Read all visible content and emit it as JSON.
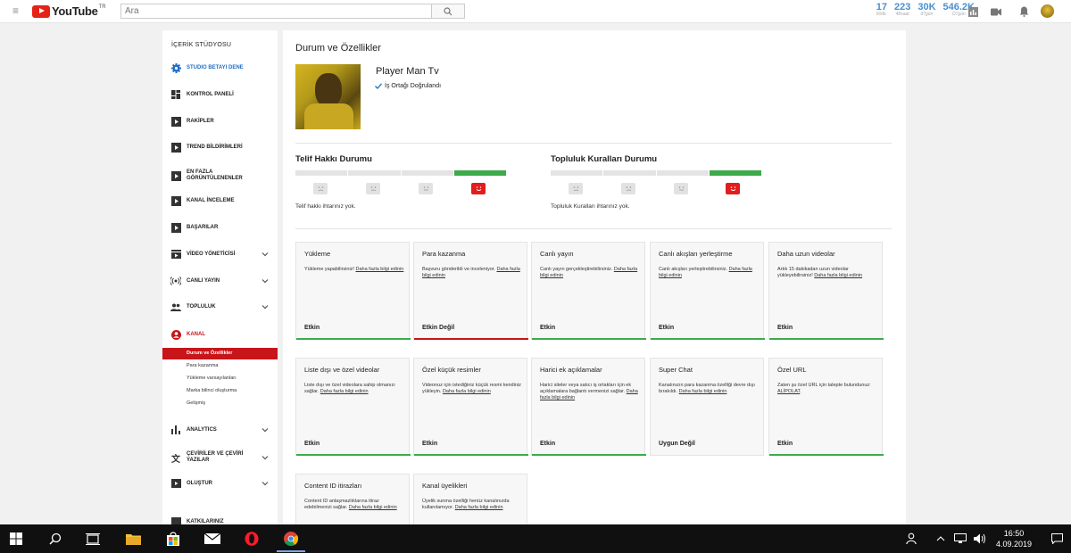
{
  "header": {
    "logo_text": "YouTube",
    "logo_region": "TR",
    "search_placeholder": "Ara",
    "stats": [
      {
        "value": "17",
        "label": "60dk."
      },
      {
        "value": "223",
        "label": "48saat"
      },
      {
        "value": "30K",
        "label": "ð7gün"
      },
      {
        "value": "546.2K",
        "label": "Ö7gün"
      }
    ]
  },
  "sidebar": {
    "title": "İÇERİK STÜDYOSU",
    "items": [
      {
        "label": "STUDIO BETAYI DENE",
        "icon": "gear-icon",
        "color": "#1f6fc3"
      },
      {
        "label": "KONTROL PANELİ",
        "icon": "dashboard-icon"
      },
      {
        "label": "RAKİPLER",
        "icon": "play-box-icon"
      },
      {
        "label": "TREND BİLDİRİMLERİ",
        "icon": "play-box-icon"
      },
      {
        "label": "EN FAZLA GÖRÜNTÜLENENLER",
        "icon": "play-box-icon"
      },
      {
        "label": "KANAL İNCELEME",
        "icon": "play-box-icon"
      },
      {
        "label": "BAŞARILAR",
        "icon": "play-box-icon"
      },
      {
        "label": "VİDEO YÖNETİCİSİ",
        "icon": "video-manager-icon"
      },
      {
        "label": "CANLI YAYIN",
        "icon": "live-icon"
      },
      {
        "label": "TOPLULUK",
        "icon": "people-icon"
      },
      {
        "label": "KANAL",
        "icon": "user-circle-icon",
        "color": "#c8151a"
      }
    ],
    "subitems": [
      "Durum ve Özellikler",
      "Para kazanma",
      "Yükleme varsayılanları",
      "Marka bilinci oluşturma",
      "Gelişmiş"
    ],
    "items_bottom": [
      {
        "label": "ANALYTICS",
        "icon": "bar-chart-icon"
      },
      {
        "label": "ÇEVİRİLER VE ÇEVİRİ YAZILAR",
        "icon": "translate-icon"
      },
      {
        "label": "OLUŞTUR",
        "icon": "film-icon"
      },
      {
        "label": "KATKILARINIZ",
        "icon": "contribution-icon"
      }
    ]
  },
  "main": {
    "title": "Durum ve Özellikler",
    "channel_name": "Player Man Tv",
    "verified_text": "İş Ortağı Doğrulandı",
    "copyright": {
      "title": "Telif Hakkı Durumu",
      "note": "Telif hakkı ihtarınız yok."
    },
    "community": {
      "title": "Topluluk Kuralları Durumu",
      "note": "Topluluk Kuralları ihtarınız yok."
    },
    "link_text": "Daha fazla bilgi edinin",
    "cards": [
      {
        "title": "Yükleme",
        "desc": "Yükleme yapabilirsiniz!",
        "status": "Etkin",
        "state": "ok"
      },
      {
        "title": "Para kazanma",
        "desc": "Başvuru gönderildi ve inceleniyor.",
        "status": "Etkin Değil",
        "state": "bad"
      },
      {
        "title": "Canlı yayın",
        "desc": "Canlı yayın gerçekleştirebilirsiniz.",
        "status": "Etkin",
        "state": "ok"
      },
      {
        "title": "Canlı akışları yerleştirme",
        "desc": "Canlı akışları yerleştirebilirsiniz.",
        "status": "Etkin",
        "state": "ok"
      },
      {
        "title": "Daha uzun videolar",
        "desc": "Artık 15 dakikadan uzun videolar yükleyebilirsiniz!",
        "status": "Etkin",
        "state": "ok"
      },
      {
        "title": "Liste dışı ve özel videolar",
        "desc": "Liste dışı ve özel videolara sahip olmanızı sağlar.",
        "status": "Etkin",
        "state": "ok"
      },
      {
        "title": "Özel küçük resimler",
        "desc": "Videonuz için istediğiniz küçük resmi kendiniz yükleyin.",
        "status": "Etkin",
        "state": "ok"
      },
      {
        "title": "Harici ek açıklamalar",
        "desc": "Harici siteler veya satıcı iş ortakları için ek açıklamalara bağlantı vermenizi sağlar.",
        "status": "Etkin",
        "state": "ok"
      },
      {
        "title": "Super Chat",
        "desc": "Kanalınızın para kazanma özelliği devre dışı bırakıldı.",
        "status": "Uygun Değil",
        "state": "none"
      },
      {
        "title": "Özel URL",
        "desc": "Zaten şu özel URL için talepte bulundunuz:",
        "url": "ALİPOLAT",
        "status": "Etkin",
        "state": "ok"
      },
      {
        "title": "Content ID itirazları",
        "desc": "Content ID anlaşmazlıklarına itiraz edebilmenizi sağlar.",
        "status": "",
        "state": "none"
      },
      {
        "title": "Kanal üyelikleri",
        "desc": "Üyelik sunma özelliği henüz kanalınızda kullanılamıyor.",
        "status": "",
        "state": "none"
      }
    ]
  },
  "taskbar": {
    "time": "16:50",
    "date": "4.09.2019"
  },
  "colors": {
    "accent_red": "#c8151a",
    "ok_green": "#3eaa4a",
    "link_blue": "#4b8fcf"
  }
}
